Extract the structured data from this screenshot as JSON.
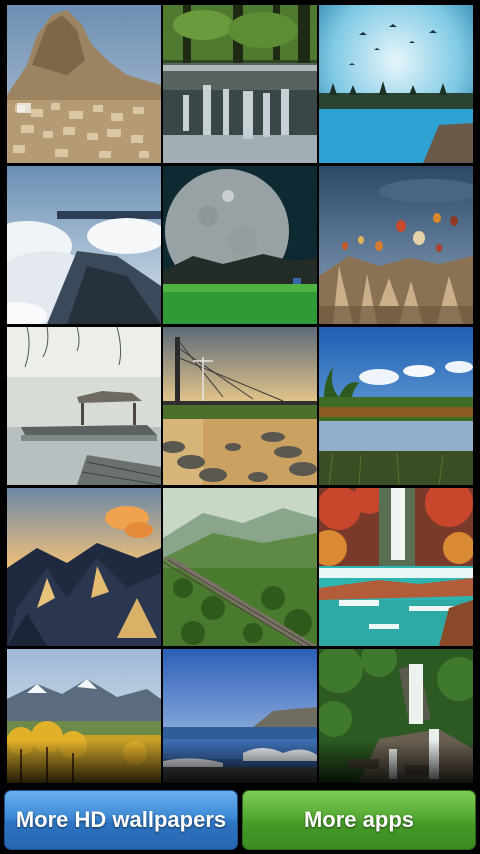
{
  "wallpapers": [
    {
      "subject": "rocky-hill-village"
    },
    {
      "subject": "forest-cascade"
    },
    {
      "subject": "blue-lake-birds"
    },
    {
      "subject": "clouds-valley"
    },
    {
      "subject": "big-moon-green-field"
    },
    {
      "subject": "hot-air-balloons"
    },
    {
      "subject": "foggy-boat-dock"
    },
    {
      "subject": "bridge-sunset-stones"
    },
    {
      "subject": "tropical-lake"
    },
    {
      "subject": "snowy-mountains-sunset"
    },
    {
      "subject": "green-mountain-railway"
    },
    {
      "subject": "autumn-waterfall-pools"
    },
    {
      "subject": "autumn-trees-mountains"
    },
    {
      "subject": "ocean-coast-waves"
    },
    {
      "subject": "jungle-waterfall"
    }
  ],
  "buttons": {
    "more_wallpapers": "More HD wallpapers",
    "more_apps": "More apps"
  },
  "colors": {
    "wallpapers_button": "#3d8ad6",
    "apps_button": "#55aa34",
    "background": "#000000"
  }
}
